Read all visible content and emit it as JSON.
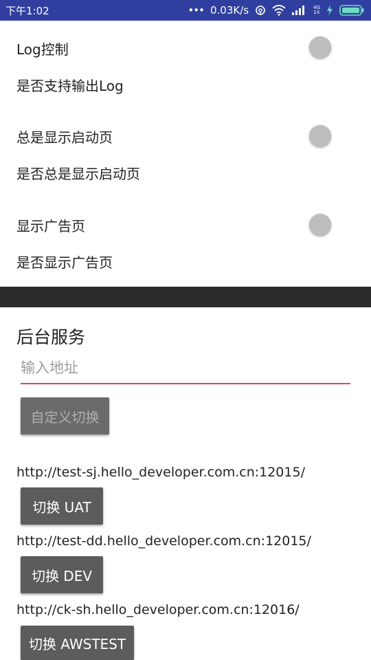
{
  "status_bar": {
    "time": "下午1:02",
    "speed": "0.03K/s",
    "signal_type_top": "4G",
    "signal_type_bottom": "1X",
    "bg_color": "#303f9f"
  },
  "settings": [
    {
      "title": "Log控制",
      "summary": "是否支持输出Log",
      "enabled": false
    },
    {
      "title": "总是显示启动页",
      "summary": "是否总是显示启动页",
      "enabled": false
    },
    {
      "title": "显示广告页",
      "summary": "是否显示广告页",
      "enabled": false
    }
  ],
  "backend": {
    "section_title": "后台服务",
    "input_placeholder": "输入地址",
    "input_value": "",
    "custom_button_label": "自定义切换",
    "accent_color": "#e0417b",
    "servers": [
      {
        "url": "http://test-sj.hello_developer.com.cn:12015/",
        "button_label": "切换 UAT"
      },
      {
        "url": "http://test-dd.hello_developer.com.cn:12015/",
        "button_label": "切换 DEV"
      },
      {
        "url": "http://ck-sh.hello_developer.com.cn:12016/",
        "button_label": "切换 AWSTEST"
      }
    ]
  }
}
